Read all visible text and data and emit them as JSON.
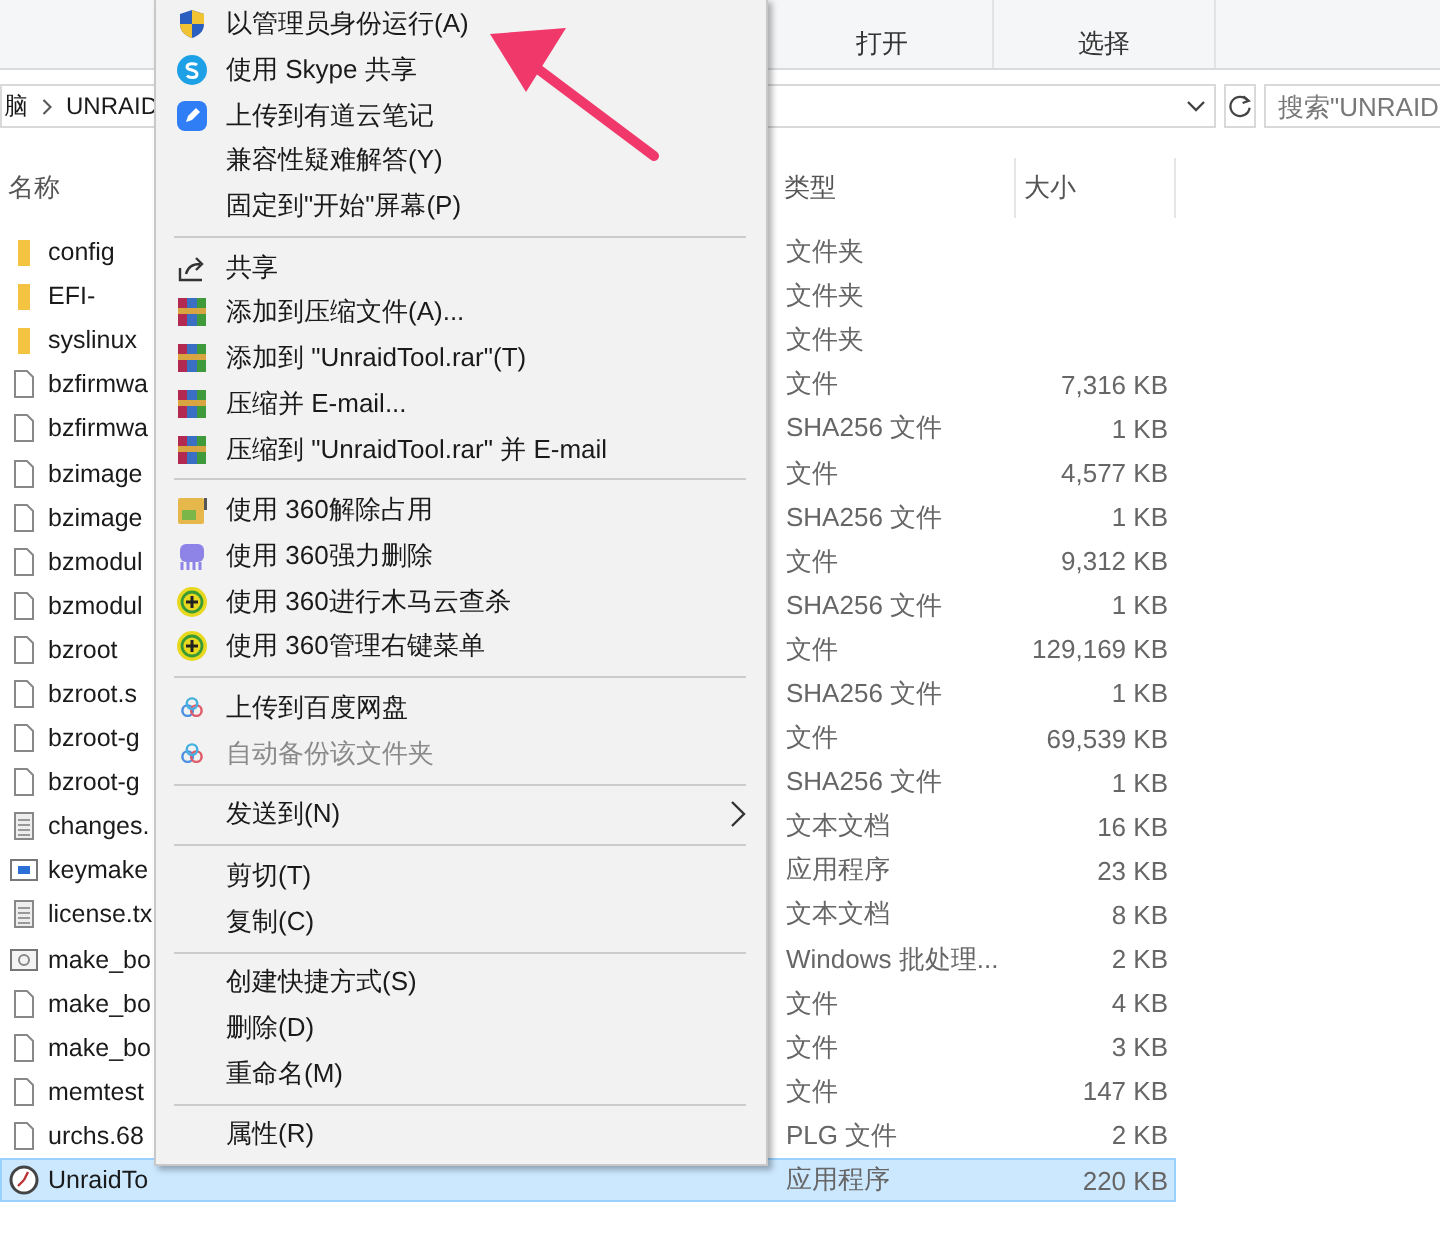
{
  "ribbon": {
    "groups": [
      {
        "label": "打开"
      },
      {
        "label": "选择"
      }
    ]
  },
  "address_bar": {
    "path": [
      "脑",
      "UNRAID"
    ],
    "search_placeholder": "搜索\"UNRAID"
  },
  "columns": [
    "名称",
    "类型",
    "大小"
  ],
  "files": [
    {
      "name": "config",
      "type": "文件夹",
      "kind": "folder",
      "selected": false
    },
    {
      "name": "EFI-",
      "type": "文件夹",
      "kind": "folder",
      "selected": false
    },
    {
      "name": "syslinux",
      "type": "文件夹",
      "kind": "folder",
      "selected": false
    },
    {
      "name": "bzfirmwa",
      "type": "文件",
      "size": "7,316 KB",
      "kind": "file",
      "selected": false
    },
    {
      "name": "bzfirmwa",
      "type": "SHA256 文件",
      "size": "1 KB",
      "kind": "file",
      "selected": false
    },
    {
      "name": "bzimage",
      "type": "文件",
      "size": "4,577 KB",
      "kind": "file",
      "selected": false
    },
    {
      "name": "bzimage",
      "type": "SHA256 文件",
      "size": "1 KB",
      "kind": "file",
      "selected": false
    },
    {
      "name": "bzmodul",
      "type": "文件",
      "size": "9,312 KB",
      "kind": "file",
      "selected": false
    },
    {
      "name": "bzmodul",
      "type": "SHA256 文件",
      "size": "1 KB",
      "kind": "file",
      "selected": false
    },
    {
      "name": "bzroot",
      "type": "文件",
      "size": "129,169 KB",
      "kind": "file",
      "selected": false
    },
    {
      "name": "bzroot.s",
      "type": "SHA256 文件",
      "size": "1 KB",
      "kind": "file",
      "selected": false
    },
    {
      "name": "bzroot-g",
      "type": "文件",
      "size": "69,539 KB",
      "kind": "file",
      "selected": false
    },
    {
      "name": "bzroot-g",
      "type": "SHA256 文件",
      "size": "1 KB",
      "kind": "file",
      "selected": false
    },
    {
      "name": "changes.",
      "type": "文本文档",
      "size": "16 KB",
      "kind": "text",
      "selected": false
    },
    {
      "name": "keymake",
      "type": "应用程序",
      "size": "23 KB",
      "kind": "app",
      "selected": false
    },
    {
      "name": "license.tx",
      "type": "文本文档",
      "size": "8 KB",
      "kind": "text",
      "selected": false
    },
    {
      "name": "make_bo",
      "type": "Windows 批处理...",
      "size": "2 KB",
      "kind": "batch",
      "selected": false
    },
    {
      "name": "make_bo",
      "type": "文件",
      "size": "4 KB",
      "kind": "file",
      "selected": false
    },
    {
      "name": "make_bo",
      "type": "文件",
      "size": "3 KB",
      "kind": "file",
      "selected": false
    },
    {
      "name": "memtest",
      "type": "文件",
      "size": "147 KB",
      "kind": "file",
      "selected": false
    },
    {
      "name": "urchs.68",
      "type": "PLG 文件",
      "size": "2 KB",
      "kind": "file",
      "selected": false
    },
    {
      "name": "UnraidTo",
      "type": "应用程序",
      "size": "220 KB",
      "kind": "exe",
      "selected": true
    }
  ],
  "context_menu": [
    {
      "kind": "shield",
      "label": "以管理员身份运行(A)",
      "disabled": false
    },
    {
      "kind": "skype",
      "label": "使用 Skype 共享",
      "disabled": false
    },
    {
      "kind": "note",
      "label": "上传到有道云笔记",
      "disabled": false
    },
    {
      "kind": "plain",
      "label": "兼容性疑难解答(Y)",
      "disabled": false
    },
    {
      "kind": "plain",
      "label": "固定到\"开始\"屏幕(P)",
      "disabled": false
    },
    {
      "kind": "separator"
    },
    {
      "kind": "share",
      "label": "共享",
      "disabled": false
    },
    {
      "kind": "archive",
      "label": "添加到压缩文件(A)...",
      "disabled": false
    },
    {
      "kind": "archive",
      "label": "添加到 \"UnraidTool.rar\"(T)",
      "disabled": false
    },
    {
      "kind": "archive",
      "label": "压缩并 E-mail...",
      "disabled": false
    },
    {
      "kind": "archive",
      "label": "压缩到 \"UnraidTool.rar\" 并 E-mail",
      "disabled": false
    },
    {
      "kind": "separator"
    },
    {
      "kind": "unlock",
      "label": "使用 360解除占用",
      "disabled": false
    },
    {
      "kind": "shred",
      "label": "使用 360强力删除",
      "disabled": false
    },
    {
      "kind": "scan",
      "label": "使用 360进行木马云查杀",
      "disabled": false
    },
    {
      "kind": "scan",
      "label": "使用 360管理右键菜单",
      "disabled": false
    },
    {
      "kind": "separator"
    },
    {
      "kind": "cloud",
      "label": "上传到百度网盘",
      "disabled": false
    },
    {
      "kind": "cloud",
      "label": "自动备份该文件夹",
      "disabled": true
    },
    {
      "kind": "separator"
    },
    {
      "kind": "submenu",
      "label": "发送到(N)",
      "disabled": false
    },
    {
      "kind": "separator"
    },
    {
      "kind": "plain",
      "label": "剪切(T)",
      "disabled": false
    },
    {
      "kind": "plain",
      "label": "复制(C)",
      "disabled": false
    },
    {
      "kind": "separator"
    },
    {
      "kind": "plain",
      "label": "创建快捷方式(S)",
      "disabled": false
    },
    {
      "kind": "plain",
      "label": "删除(D)",
      "disabled": false
    },
    {
      "kind": "plain",
      "label": "重命名(M)",
      "disabled": false
    },
    {
      "kind": "separator"
    },
    {
      "kind": "plain",
      "label": "属性(R)",
      "disabled": false
    }
  ]
}
